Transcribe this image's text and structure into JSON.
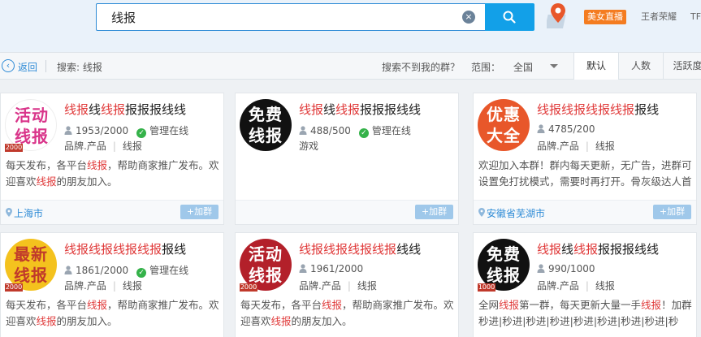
{
  "search": {
    "value": "线报",
    "clear": "×"
  },
  "header": {
    "live_badge": "美女直播",
    "link_1": "王者荣耀",
    "link_2": "TF"
  },
  "filter": {
    "back": "返回",
    "back_glyph": "‹",
    "summary": "搜索: 线报",
    "notfound": "搜索不到我的群？",
    "range_label": "范围：",
    "range_value": "全国",
    "tabs": [
      "默认",
      "人数",
      "活跃度"
    ]
  },
  "join_label": "+加群",
  "check_glyph": "✓",
  "cards": [
    {
      "avatar": "活动\n线报",
      "avatar_color": "#d9358a",
      "avatar_bg": "#ffffff",
      "tag": "2000",
      "title": [
        [
          "线报",
          1
        ],
        [
          "线",
          0
        ],
        [
          "线报",
          1
        ],
        [
          "报报报线线",
          0
        ]
      ],
      "members": "1953/2000",
      "admin": "管理在线",
      "tags": [
        "品牌.产品",
        "线报"
      ],
      "desc": [
        [
          "每天发布，各平台",
          0
        ],
        [
          "线报",
          1
        ],
        [
          "，帮助商家推广发布。欢迎喜欢",
          0
        ],
        [
          "线报",
          1
        ],
        [
          "的朋友加入。",
          0
        ]
      ],
      "location": "上海市"
    },
    {
      "avatar": "免费\n线报",
      "avatar_color": "#ffffff",
      "avatar_bg": "#111111",
      "tag": "",
      "title": [
        [
          "线报",
          1
        ],
        [
          "线",
          0
        ],
        [
          "线报",
          1
        ],
        [
          "报报报线线",
          0
        ]
      ],
      "members": "488/500",
      "admin": "管理在线",
      "tags": [
        "游戏"
      ],
      "desc": [],
      "location": ""
    },
    {
      "avatar": "优惠\n大全",
      "avatar_color": "#ffffff",
      "avatar_bg": "#e8572a",
      "tag": "",
      "title": [
        [
          "线报",
          1
        ],
        [
          "线报",
          1
        ],
        [
          "线报",
          1
        ],
        [
          "线报",
          1
        ],
        [
          "报线",
          0
        ]
      ],
      "members": "4785/200",
      "admin": "",
      "tags": [
        "品牌.产品",
        "线报"
      ],
      "desc": [
        [
          "欢迎加入本群！群内每天更新，无广告，进群可设置免打扰模式，需要时再打开。骨灰级达人首选！",
          0
        ]
      ],
      "location": "安徽省芜湖市"
    },
    {
      "avatar": "最新\n线报",
      "avatar_color": "#c0392b",
      "avatar_bg": "#f4c21e",
      "tag": "2000",
      "title": [
        [
          "线报",
          1
        ],
        [
          "线报",
          1
        ],
        [
          "线报",
          1
        ],
        [
          "线报",
          1
        ],
        [
          "报线",
          0
        ]
      ],
      "members": "1861/2000",
      "admin": "管理在线",
      "tags": [
        "品牌.产品",
        "线报"
      ],
      "desc": [
        [
          "每天发布，各平台",
          0
        ],
        [
          "线报",
          1
        ],
        [
          "，帮助商家推广发布。欢迎喜欢",
          0
        ],
        [
          "线报",
          1
        ],
        [
          "的朋友加入。",
          0
        ]
      ],
      "location": ""
    },
    {
      "avatar": "活动\n线报",
      "avatar_color": "#ffffff",
      "avatar_bg": "#b3202a",
      "tag": "2000",
      "title": [
        [
          "线报",
          1
        ],
        [
          "线报",
          1
        ],
        [
          "线报",
          1
        ],
        [
          "线报",
          1
        ],
        [
          "线线",
          0
        ]
      ],
      "members": "1961/2000",
      "admin": "",
      "tags": [
        "品牌.产品",
        "线报"
      ],
      "desc": [
        [
          "每天发布，各平台",
          0
        ],
        [
          "线报",
          1
        ],
        [
          "，帮助商家推广发布。欢迎喜欢",
          0
        ],
        [
          "线报",
          1
        ],
        [
          "的朋友加入。",
          0
        ]
      ],
      "location": ""
    },
    {
      "avatar": "免费\n线报",
      "avatar_color": "#ffffff",
      "avatar_bg": "#111111",
      "tag": "1000",
      "title": [
        [
          "线报",
          1
        ],
        [
          "线",
          0
        ],
        [
          "线报",
          1
        ],
        [
          "报报报线线",
          0
        ]
      ],
      "members": "990/1000",
      "admin": "",
      "tags": [
        "品牌.产品",
        "线报"
      ],
      "desc": [
        [
          "全网",
          0
        ],
        [
          "线报",
          1
        ],
        [
          "第一群，每天更新大量一手",
          0
        ],
        [
          "线报",
          1
        ],
        [
          "！加群秒进|秒进|秒进|秒进|秒进|秒进|秒进|秒进|秒",
          0
        ]
      ],
      "location": ""
    }
  ]
}
